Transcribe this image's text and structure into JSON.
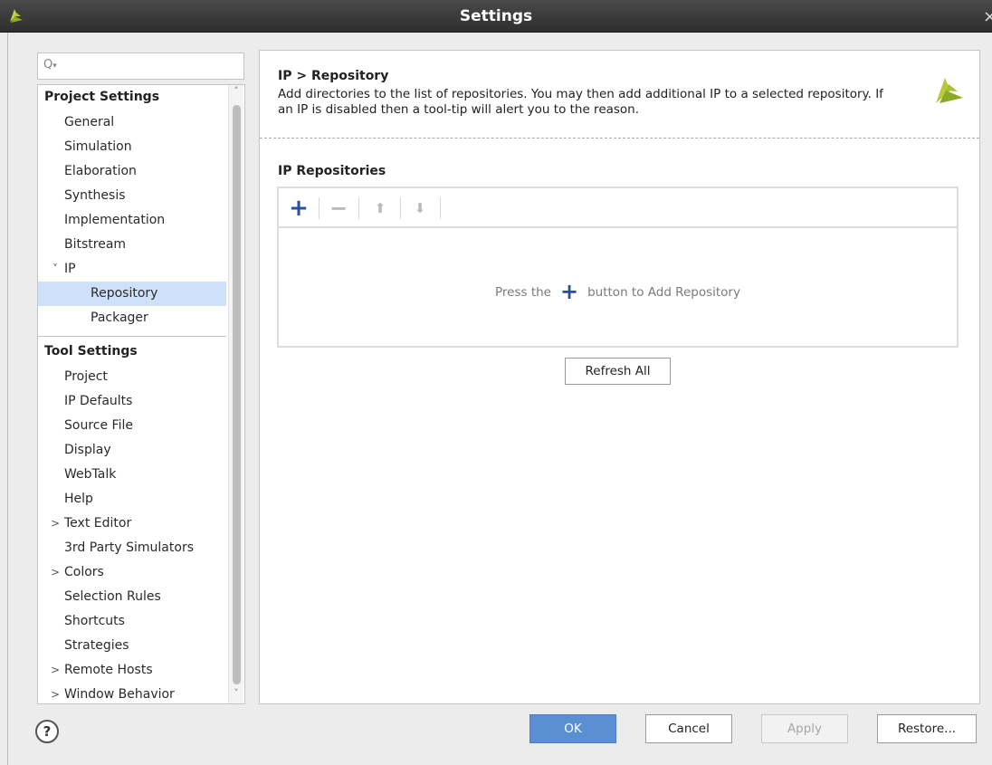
{
  "window": {
    "title": "Settings",
    "close_glyph": "×"
  },
  "search": {
    "placeholder": "",
    "icon": "search-icon"
  },
  "tree": {
    "project_settings_title": "Project Settings",
    "project_items": [
      {
        "label": "General"
      },
      {
        "label": "Simulation"
      },
      {
        "label": "Elaboration"
      },
      {
        "label": "Synthesis"
      },
      {
        "label": "Implementation"
      },
      {
        "label": "Bitstream"
      },
      {
        "label": "IP"
      },
      {
        "label": "Repository"
      },
      {
        "label": "Packager"
      }
    ],
    "tool_settings_title": "Tool Settings",
    "tool_items": [
      {
        "label": "Project"
      },
      {
        "label": "IP Defaults"
      },
      {
        "label": "Source File"
      },
      {
        "label": "Display"
      },
      {
        "label": "WebTalk"
      },
      {
        "label": "Help"
      },
      {
        "label": "Text Editor"
      },
      {
        "label": "3rd Party Simulators"
      },
      {
        "label": "Colors"
      },
      {
        "label": "Selection Rules"
      },
      {
        "label": "Shortcuts"
      },
      {
        "label": "Strategies"
      },
      {
        "label": "Remote Hosts"
      },
      {
        "label": "Window Behavior"
      }
    ],
    "selected": "Repository",
    "expanded_chevron": "˅",
    "collapsed_chevron": ">"
  },
  "content": {
    "breadcrumb": "IP > Repository",
    "description": "Add directories to the list of repositories. You may then add additional IP to a selected repository. If an IP is disabled then a tool-tip will alert you to the reason.",
    "section_heading": "IP Repositories",
    "empty_prefix": "Press the",
    "empty_suffix": "button to Add Repository",
    "refresh_label": "Refresh All"
  },
  "buttons": {
    "help": "?",
    "ok": "OK",
    "cancel": "Cancel",
    "apply": "Apply",
    "restore": "Restore..."
  },
  "colors": {
    "accent": "#5b8fd3",
    "selection": "#cfe0fb",
    "add_icon": "#2b4f9c",
    "logo_green": "#9cb82a"
  }
}
